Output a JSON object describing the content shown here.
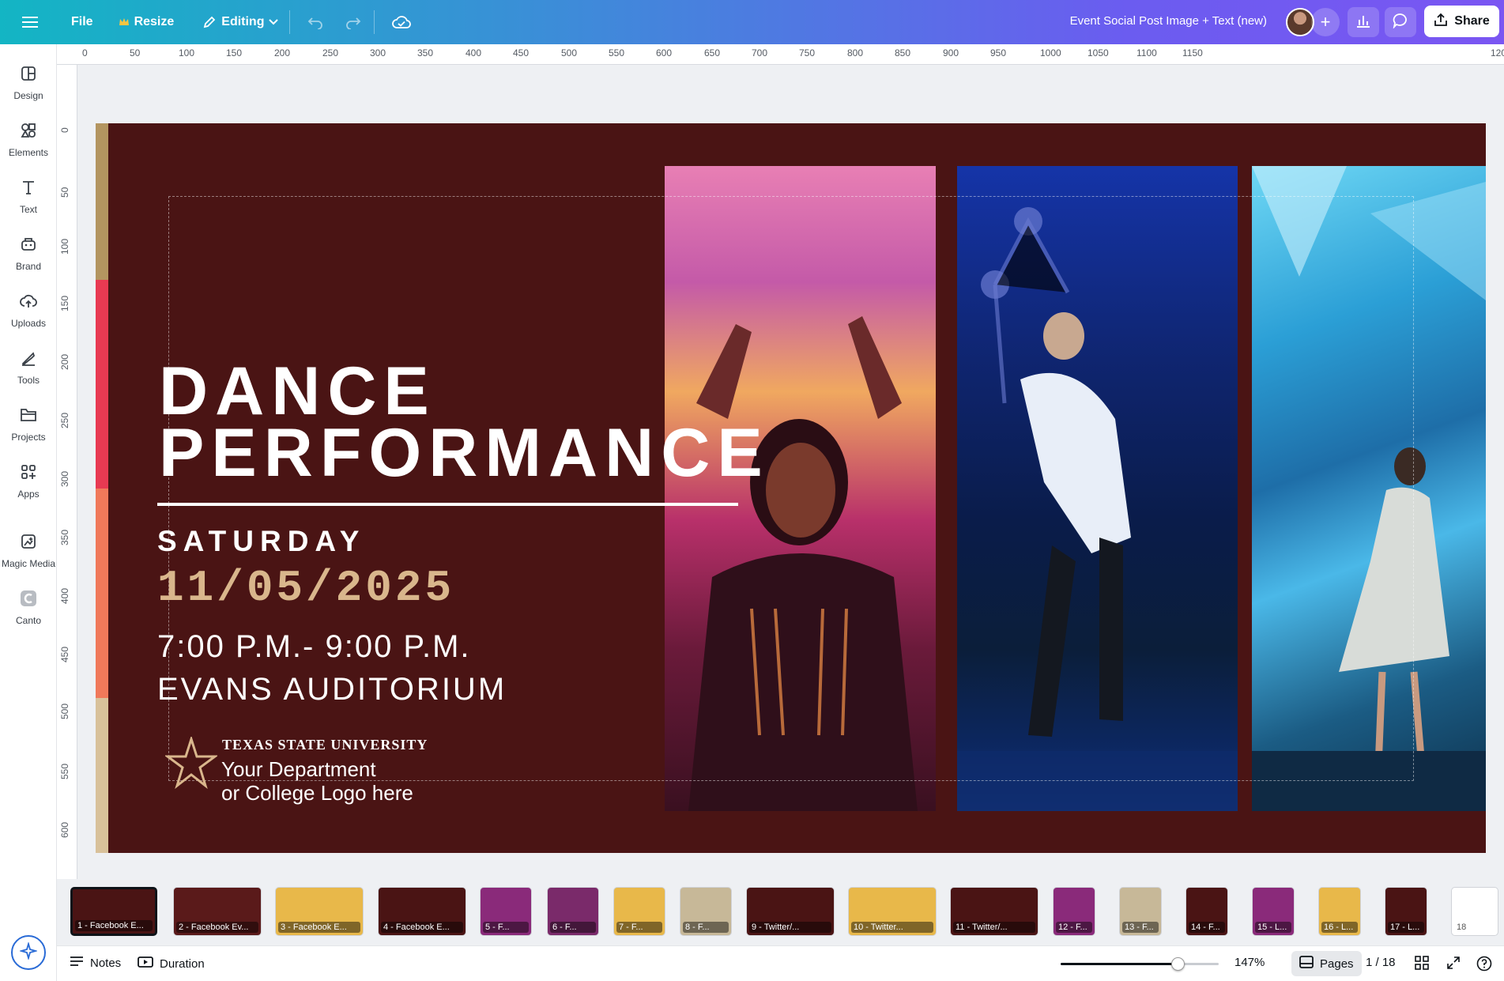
{
  "topbar": {
    "file_label": "File",
    "resize_label": "Resize",
    "editing_label": "Editing",
    "doc_title": "Event Social Post Image + Text (new)",
    "share_label": "Share"
  },
  "sidebar": {
    "items": [
      {
        "label": "Design",
        "icon": "design-icon"
      },
      {
        "label": "Elements",
        "icon": "elements-icon"
      },
      {
        "label": "Text",
        "icon": "text-icon"
      },
      {
        "label": "Brand",
        "icon": "brand-icon"
      },
      {
        "label": "Uploads",
        "icon": "uploads-icon"
      },
      {
        "label": "Tools",
        "icon": "tools-icon"
      },
      {
        "label": "Projects",
        "icon": "projects-icon"
      },
      {
        "label": "Apps",
        "icon": "apps-icon"
      },
      {
        "label": "Magic Media",
        "icon": "magic-media-icon"
      },
      {
        "label": "Canto",
        "icon": "canto-icon"
      }
    ]
  },
  "ruler": {
    "top": [
      "0",
      "50",
      "100",
      "150",
      "200",
      "250",
      "300",
      "350",
      "400",
      "450",
      "500",
      "550",
      "600",
      "650",
      "700",
      "750",
      "800",
      "850",
      "900",
      "950",
      "1000",
      "1050",
      "1100",
      "1150",
      "120"
    ],
    "left": [
      "0",
      "50",
      "100",
      "150",
      "200",
      "250",
      "300",
      "350",
      "400",
      "450",
      "500",
      "550",
      "600"
    ]
  },
  "design": {
    "title_line1": "DANCE",
    "title_line2": "PERFORMANCE",
    "day": "SATURDAY",
    "date": "11/05/2025",
    "time": "7:00 P.M.- 9:00 P.M.",
    "venue": "EVANS AUDITORIUM",
    "university": "TEXAS STATE UNIVERSITY",
    "dept_line1": "Your Department",
    "dept_line2": "or College Logo here",
    "colors": {
      "background": "#4a1414",
      "accent_gold": "#d9b68c"
    }
  },
  "pages": {
    "thumbs": [
      {
        "label": "1 - Facebook E...",
        "bg": "#4a1414"
      },
      {
        "label": "2 - Facebook Ev...",
        "bg": "#5a1a1a"
      },
      {
        "label": "3 - Facebook E...",
        "bg": "#e8b84a"
      },
      {
        "label": "4 - Facebook E...",
        "bg": "#4a1414"
      },
      {
        "label": "5 - F...",
        "bg": "#8a2a7a"
      },
      {
        "label": "6 - F...",
        "bg": "#7a2a6a"
      },
      {
        "label": "7 - F...",
        "bg": "#e8b84a"
      },
      {
        "label": "8 - F...",
        "bg": "#c7b898"
      },
      {
        "label": "9 - Twitter/...",
        "bg": "#4a1414"
      },
      {
        "label": "10 - Twitter...",
        "bg": "#e8b84a"
      },
      {
        "label": "11 - Twitter/...",
        "bg": "#4a1414"
      },
      {
        "label": "12 - F...",
        "bg": "#8a2a7a"
      },
      {
        "label": "13 - F...",
        "bg": "#c7b898"
      },
      {
        "label": "14 - F...",
        "bg": "#4a1414"
      },
      {
        "label": "15 - L...",
        "bg": "#8a2a7a"
      },
      {
        "label": "16 - L...",
        "bg": "#e8b84a"
      },
      {
        "label": "17 - L...",
        "bg": "#4a1414"
      },
      {
        "label": "18",
        "bg": "#ffffff"
      }
    ]
  },
  "bottombar": {
    "notes_label": "Notes",
    "duration_label": "Duration",
    "zoom": "147%",
    "zoom_fraction": 0.74,
    "pages_label": "Pages",
    "page_counter": "1 / 18"
  }
}
